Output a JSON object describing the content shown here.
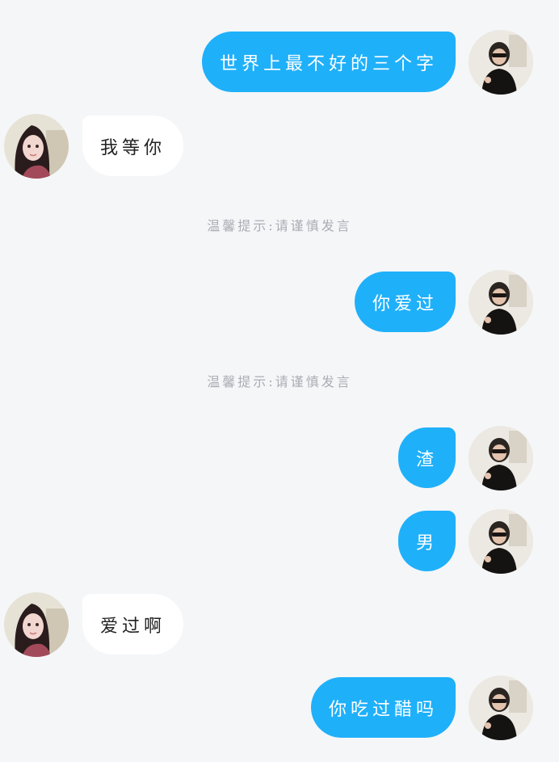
{
  "messages": [
    {
      "side": "right",
      "text": "世界上最不好的三个字"
    },
    {
      "side": "left",
      "text": "我等你"
    },
    {
      "type": "notice",
      "text": "温馨提示:请谨慎发言"
    },
    {
      "side": "right",
      "text": "你爱过"
    },
    {
      "type": "notice",
      "text": "温馨提示:请谨慎发言"
    },
    {
      "side": "right",
      "text": "渣"
    },
    {
      "side": "right",
      "text": "男"
    },
    {
      "side": "left",
      "text": "爱过啊"
    },
    {
      "side": "right",
      "text": "你吃过醋吗"
    }
  ],
  "colors": {
    "outgoing_bubble": "#1fb0fa",
    "incoming_bubble": "#ffffff",
    "background": "#f5f6f8",
    "notice_text": "#a9adb3"
  }
}
